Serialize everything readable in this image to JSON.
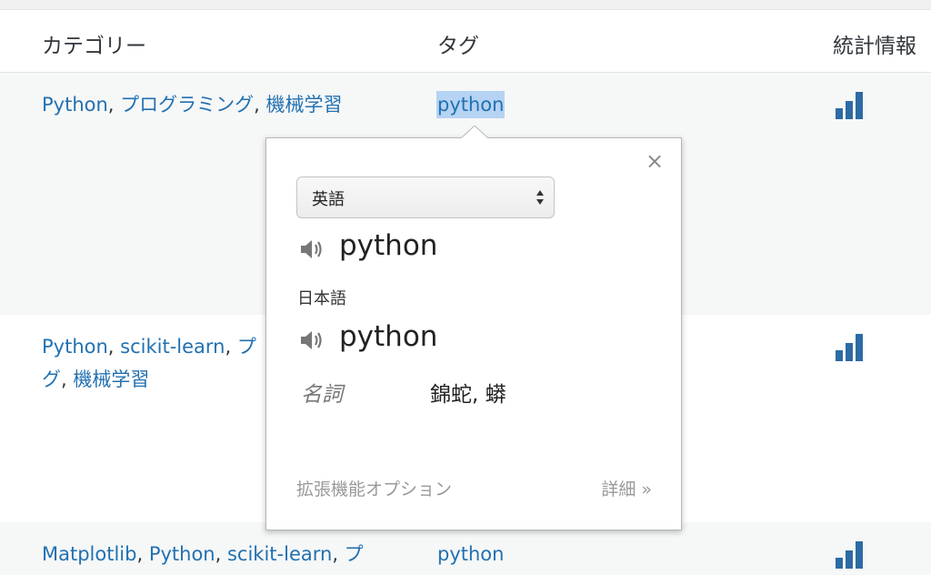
{
  "table": {
    "headers": {
      "categories": "カテゴリー",
      "tags": "タグ",
      "stats": "統計情報"
    },
    "rows": [
      {
        "categories": [
          {
            "text": "Python",
            "sep": ", "
          },
          {
            "text": "プログラミング",
            "sep": ", "
          },
          {
            "text": "機械学習",
            "sep": ""
          }
        ],
        "tag": "python"
      },
      {
        "categories_line1": [
          {
            "text": "Python",
            "sep": ", "
          },
          {
            "text": "scikit-learn",
            "sep": ", "
          },
          {
            "text": "プ",
            "sep": ""
          }
        ],
        "categories_line2": [
          {
            "text": "グ",
            "sep": ", "
          },
          {
            "text": "機械学習",
            "sep": ""
          }
        ]
      },
      {
        "categories": [
          {
            "text": "Matplotlib",
            "sep": ", "
          },
          {
            "text": "Python",
            "sep": ", "
          },
          {
            "text": "scikit-learn",
            "sep": ", "
          },
          {
            "text": "プ",
            "sep": ""
          }
        ],
        "tag": "python"
      }
    ]
  },
  "translate_popup": {
    "close_symbol": "×",
    "source_language": "英語",
    "source_word": "python",
    "target_language_label": "日本語",
    "target_word": "python",
    "part_of_speech": "名詞",
    "meaning": "錦蛇, 蟒",
    "extension_options": "拡張機能オプション",
    "details": "詳細 »"
  },
  "colors": {
    "link": "#2271b1",
    "stats_icon": "#2c6ba4",
    "selection": "#b5d3f3"
  },
  "icons": [
    "speaker-icon",
    "close-icon",
    "stats-bar-icon",
    "select-arrows-icon"
  ]
}
